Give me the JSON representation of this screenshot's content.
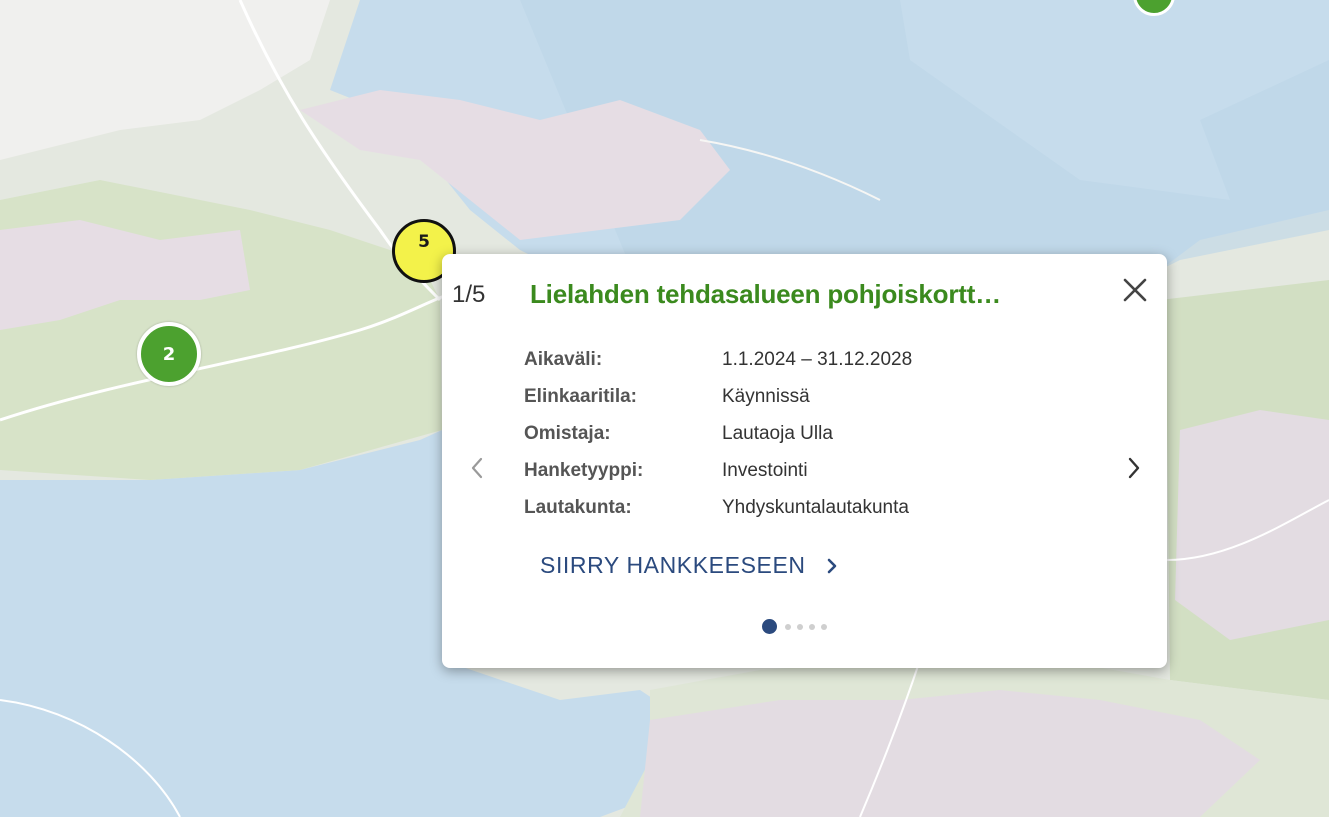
{
  "map": {
    "clusters": [
      {
        "label": "2",
        "color": "#4ca12f"
      },
      {
        "label": "5",
        "color": "#f3f24a"
      }
    ]
  },
  "popup": {
    "counter": "1/5",
    "title": "Lielahden tehdasalueen pohjoiskortt…",
    "title_color": "#3b8a1e",
    "details": [
      {
        "label": "Aikaväli:",
        "value": "1.1.2024 – 31.12.2028"
      },
      {
        "label": "Elinkaaritila:",
        "value": "Käynnissä"
      },
      {
        "label": "Omistaja:",
        "value": "Lautaoja Ulla"
      },
      {
        "label": "Hanketyyppi:",
        "value": "Investointi"
      },
      {
        "label": "Lautakunta:",
        "value": "Yhdyskuntalautakunta"
      }
    ],
    "link_label": "SIIRRY HANKKEESEEN",
    "link_color": "#2b4a7e",
    "pages_total": 5,
    "current_page": 1
  },
  "icons": {
    "close": "close-icon",
    "prev": "chevron-left-icon",
    "next": "chevron-right-icon",
    "link": "chevron-right-icon"
  }
}
